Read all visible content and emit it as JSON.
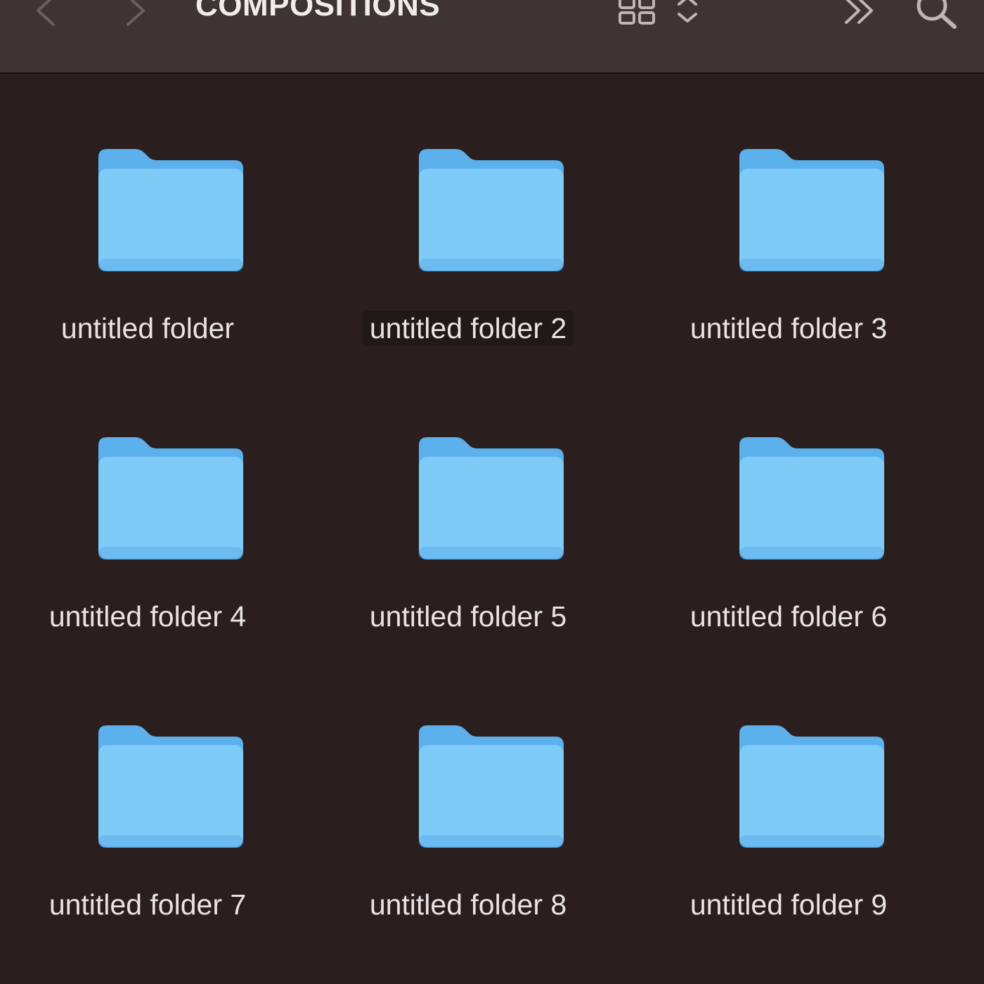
{
  "toolbar": {
    "title": "COMPOSITIONS",
    "back_icon": "chevron-left-icon",
    "forward_icon": "chevron-right-icon",
    "view_icon": "grid-view-icon",
    "sort_icon": "up-down-chevron-icon",
    "more_icon": "double-chevron-right-icon",
    "search_icon": "search-icon"
  },
  "colors": {
    "background": "#2a1f1e",
    "toolbar": "#3e3533",
    "folder_front": "#7ecbf8",
    "folder_back": "#5cb0ec",
    "label_text": "#e9e4e3"
  },
  "folders": [
    {
      "label": "untitled folder",
      "highlighted": false
    },
    {
      "label": "untitled folder 2",
      "highlighted": true
    },
    {
      "label": "untitled folder 3",
      "highlighted": false
    },
    {
      "label": "untitled folder 4",
      "highlighted": false
    },
    {
      "label": "untitled folder 5",
      "highlighted": false
    },
    {
      "label": "untitled folder 6",
      "highlighted": false
    },
    {
      "label": "untitled folder 7",
      "highlighted": false
    },
    {
      "label": "untitled folder 8",
      "highlighted": false
    },
    {
      "label": "untitled folder 9",
      "highlighted": false
    }
  ]
}
